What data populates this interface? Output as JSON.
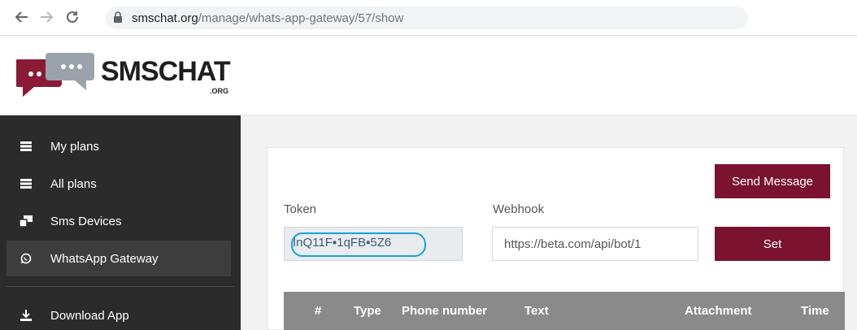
{
  "browser": {
    "url_host": "smschat.org",
    "url_path": "/manage/whats-app-gateway/57/show"
  },
  "logo": {
    "text": "SMSCHAT",
    "sub": ".ORG"
  },
  "sidebar": {
    "items": [
      {
        "label": "My plans",
        "icon": "list-icon"
      },
      {
        "label": "All plans",
        "icon": "list-icon"
      },
      {
        "label": "Sms Devices",
        "icon": "devices-icon"
      },
      {
        "label": "WhatsApp Gateway",
        "icon": "whatsapp-icon",
        "active": true
      },
      {
        "label": "Download App",
        "icon": "download-icon"
      }
    ]
  },
  "main": {
    "send_button": "Send Message",
    "token_label": "Token",
    "token_value": "InQ11F▪1qFB▪5Z6",
    "webhook_label": "Webhook",
    "webhook_value": "https://beta.com/api/bot/1",
    "set_button": "Set",
    "table_headers": [
      "#",
      "Type",
      "Phone number",
      "Text",
      "Attachment",
      "Time"
    ]
  },
  "colors": {
    "accent": "#7a1230",
    "sidebar_bg": "#2b2b2b",
    "table_head": "#8a8a8a",
    "highlight_ring": "#1aa0d8"
  }
}
